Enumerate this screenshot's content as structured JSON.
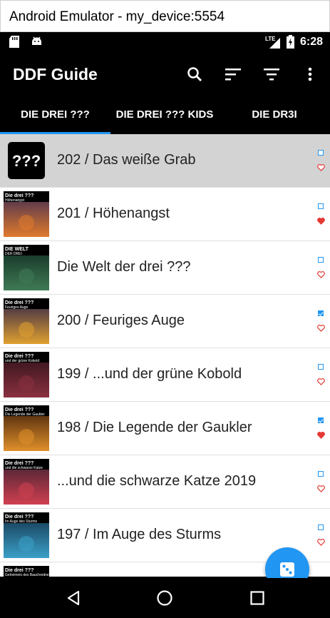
{
  "window": {
    "title": "Android Emulator - my_device:5554"
  },
  "status_bar": {
    "network": "LTE",
    "time": "6:28",
    "icons": [
      "sd-card-icon",
      "android-icon",
      "signal-icon",
      "battery-charging-icon"
    ]
  },
  "app_bar": {
    "title": "DDF Guide",
    "actions": [
      "search-icon",
      "sort-icon",
      "filter-icon",
      "more-vert-icon"
    ]
  },
  "tabs": [
    {
      "label": "DIE DREI ???",
      "selected": true
    },
    {
      "label": "DIE DREI ??? KIDS",
      "selected": false
    },
    {
      "label": "DIE DR3I",
      "selected": false
    }
  ],
  "episodes": [
    {
      "title": "202 / Das weiße Grab",
      "checked": false,
      "favorite": false,
      "selected": true,
      "cover": "placeholder",
      "cover_text": "???"
    },
    {
      "title": "201 / Höhenangst",
      "checked": false,
      "favorite": true,
      "cover": "image",
      "cover_line1": "Die drei ???",
      "cover_line2": "Höhenangst",
      "colors": [
        "#3b2a55",
        "#e07a2c"
      ]
    },
    {
      "title": "Die Welt der drei ???",
      "checked": false,
      "favorite": false,
      "cover": "image",
      "cover_line1": "DIE WELT",
      "cover_line2": "DER DREI",
      "colors": [
        "#0f2a20",
        "#3f7a55"
      ]
    },
    {
      "title": "200 / Feuriges Auge",
      "checked": true,
      "favorite": false,
      "cover": "image",
      "cover_line1": "Die drei ???",
      "cover_line2": "Feuriges Auge",
      "colors": [
        "#2a1f4a",
        "#e0a030"
      ]
    },
    {
      "title": "199 / ...und der grüne Kobold",
      "checked": false,
      "favorite": false,
      "cover": "image",
      "cover_line1": "Die drei ???",
      "cover_line2": "und der grüne Kobold",
      "colors": [
        "#2a1216",
        "#8a3040"
      ]
    },
    {
      "title": "198 / Die Legende der Gaukler",
      "checked": true,
      "favorite": true,
      "cover": "image",
      "cover_line1": "Die drei ???",
      "cover_line2": "Die Legende der Gaukler",
      "colors": [
        "#3a1a0a",
        "#e0902a"
      ]
    },
    {
      "title": "...und die schwarze Katze 2019",
      "checked": false,
      "favorite": false,
      "cover": "image",
      "cover_line1": "Die drei ???",
      "cover_line2": "und die schwarze Katze",
      "colors": [
        "#3a2030",
        "#d04050"
      ]
    },
    {
      "title": "197 / Im Auge des Sturms",
      "checked": false,
      "favorite": false,
      "cover": "image",
      "cover_line1": "Die drei ???",
      "cover_line2": "Im Auge des Sturms",
      "colors": [
        "#123048",
        "#3aa0c8"
      ]
    },
    {
      "title": "",
      "checked": false,
      "favorite": false,
      "cover": "image",
      "cover_line1": "Die drei ???",
      "cover_line2": "Geheimnis des Bauchredners",
      "colors": [
        "#301a1a",
        "#905040"
      ]
    }
  ],
  "fab": {
    "icon": "dice-icon"
  },
  "nav_bar": [
    "back-icon",
    "home-icon",
    "recents-icon"
  ],
  "colors": {
    "accent": "#2196f3",
    "heart": "#e53935",
    "selected_row": "#d3d3d3"
  }
}
